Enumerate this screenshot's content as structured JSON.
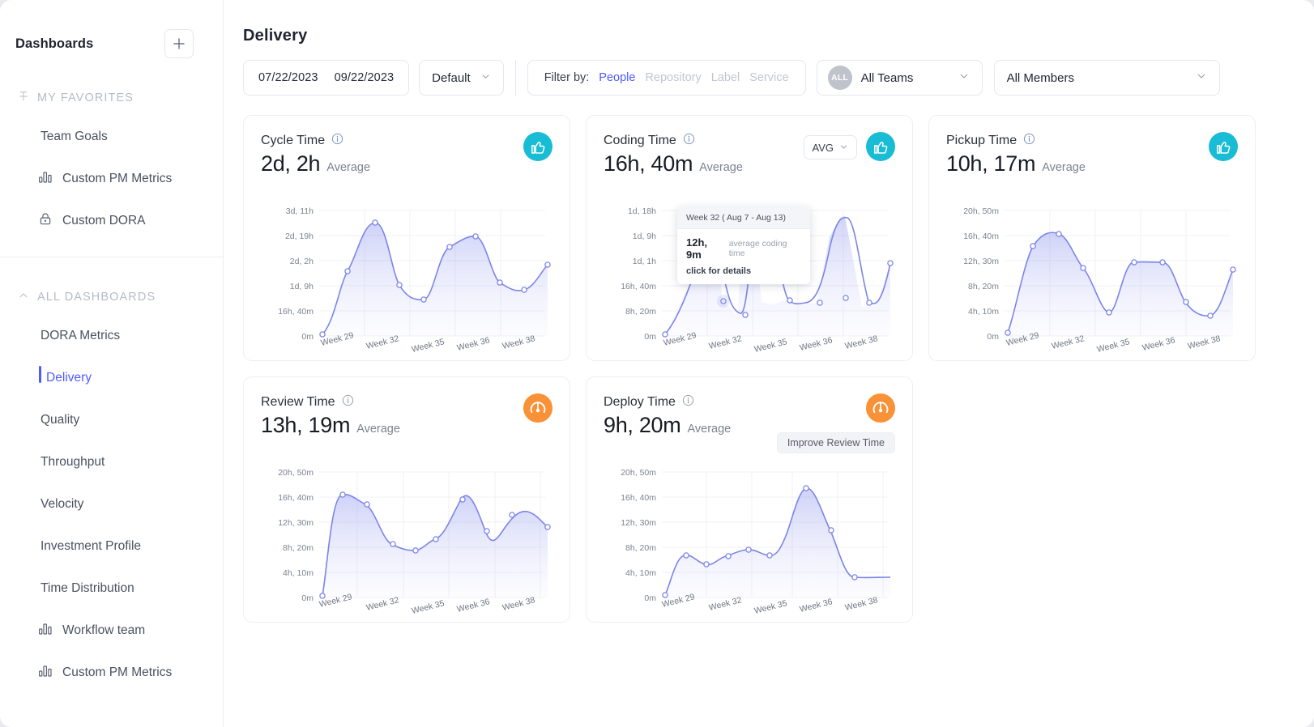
{
  "sidebar": {
    "title": "Dashboards",
    "add_button": "+",
    "sections": [
      {
        "label": "MY  FAVORITES",
        "icon": "pin-icon"
      },
      {
        "label": "ALL DASHBOARDS",
        "icon": "chevron-up-icon"
      }
    ],
    "favorites": [
      {
        "label": "Team Goals",
        "icon": null
      },
      {
        "label": "Custom PM Metrics",
        "icon": "bar-chart-icon"
      },
      {
        "label": "Custom DORA",
        "icon": "lock-icon"
      }
    ],
    "all_dashboards": [
      {
        "label": "DORA Metrics",
        "icon": null,
        "active": false
      },
      {
        "label": "Delivery",
        "icon": null,
        "active": true
      },
      {
        "label": "Quality",
        "icon": null,
        "active": false
      },
      {
        "label": "Throughput",
        "icon": null,
        "active": false
      },
      {
        "label": "Velocity",
        "icon": null,
        "active": false
      },
      {
        "label": "Investment Profile",
        "icon": null,
        "active": false
      },
      {
        "label": "Time Distribution",
        "icon": null,
        "active": false
      },
      {
        "label": "Workflow team",
        "icon": "bar-chart-icon",
        "active": false
      },
      {
        "label": "Custom PM Metrics",
        "icon": "bar-chart-icon",
        "active": false
      }
    ]
  },
  "header": {
    "title": "Delivery"
  },
  "toolbar": {
    "date_from": "07/22/2023",
    "date_to": "09/22/2023",
    "preset": "Default",
    "filter_label": "Filter by:",
    "filter_options": [
      {
        "label": "People",
        "selected": true
      },
      {
        "label": "Repository",
        "selected": false
      },
      {
        "label": "Label",
        "selected": false
      },
      {
        "label": "Service",
        "selected": false
      }
    ],
    "team_avatar": "ALL",
    "team": "All Teams",
    "members": "All Members"
  },
  "accent_colors": {
    "brand_blue": "#4f5bff",
    "line": "#7b85e8",
    "good_badge": "#18bcd4",
    "warn_badge": "#f99136"
  },
  "cards": [
    {
      "title": "Cycle Time",
      "value": "2d, 2h",
      "unit": "Average",
      "badge": "thumbs-up-icon",
      "badge_kind": "good",
      "selector": null,
      "pill": null
    },
    {
      "title": "Coding Time",
      "value": "16h, 40m",
      "unit": "Average",
      "badge": "thumbs-up-icon",
      "badge_kind": "good",
      "selector": "AVG",
      "pill": null,
      "tooltip": {
        "header": "Week 32 ( Aug 7 - Aug 13)",
        "value": "12h, 9m",
        "label": "average coding time",
        "hint": "click for details"
      }
    },
    {
      "title": "Pickup Time",
      "value": "10h, 17m",
      "unit": "Average",
      "badge": "thumbs-up-icon",
      "badge_kind": "good",
      "selector": null,
      "pill": null
    },
    {
      "title": "Review Time",
      "value": "13h, 19m",
      "unit": "Average",
      "badge": "gauge-icon",
      "badge_kind": "warn",
      "selector": null,
      "pill": null
    },
    {
      "title": "Deploy Time",
      "value": "9h, 20m",
      "unit": "Average",
      "badge": "gauge-icon",
      "badge_kind": "warn",
      "selector": null,
      "pill": "Improve Review Time"
    }
  ],
  "chart_data": [
    {
      "type": "area",
      "title": "Cycle Time",
      "xlabel": "",
      "ylabel": "",
      "grid": true,
      "legend": "none",
      "x": [
        "Week 29",
        "",
        "",
        "Week 32",
        "",
        "",
        "Week 35",
        "",
        "Week 36",
        "",
        "",
        "Week 38",
        ""
      ],
      "tick_labels": [
        "Week 29",
        "Week 32",
        "Week 35",
        "Week 36",
        "Week 38"
      ],
      "ytick_labels": [
        "0m",
        "16h, 40m",
        "1d, 9h",
        "2d, 2h",
        "2d, 19h",
        "3d, 11h"
      ],
      "yticks": [
        0,
        1,
        2,
        3,
        4,
        5
      ],
      "ylim": [
        0,
        5.4
      ],
      "values": [
        0.08,
        3.35,
        4.1,
        2.42,
        1.55,
        3.15,
        3.65,
        2.6,
        1.78,
        2.9
      ]
    },
    {
      "type": "area",
      "title": "Coding Time",
      "xlabel": "",
      "ylabel": "",
      "grid": true,
      "legend": "none",
      "tick_labels": [
        "Week 29",
        "Week 32",
        "Week 35",
        "Week 36",
        "Week 38"
      ],
      "ytick_labels": [
        "0m",
        "8h, 20m",
        "16h, 40m",
        "1d, 1h",
        "1d, 9h",
        "1d, 18h"
      ],
      "ylim": [
        0,
        5.4
      ],
      "values": [
        0.08,
        3.1,
        4.9,
        1.45,
        0.85,
        4.6,
        3.6,
        1.15,
        1.45,
        1.15,
        3.5
      ]
    },
    {
      "type": "area",
      "title": "Pickup Time",
      "xlabel": "",
      "ylabel": "",
      "grid": true,
      "legend": "none",
      "tick_labels": [
        "Week 29",
        "Week 32",
        "Week 35",
        "Week 36",
        "Week 38"
      ],
      "ytick_labels": [
        "0m",
        "4h, 10m",
        "8h, 20m",
        "12h, 30m",
        "16h, 40m",
        "20h, 50m"
      ],
      "ylim": [
        0,
        5.4
      ],
      "values": [
        0.15,
        3.65,
        4.1,
        2.75,
        1.25,
        2.98,
        2.98,
        1.65,
        1.1,
        2.5,
        3.55
      ]
    },
    {
      "type": "area",
      "title": "Review Time",
      "xlabel": "",
      "ylabel": "",
      "grid": true,
      "legend": "none",
      "tick_labels": [
        "Week 29",
        "Week 32",
        "Week 35",
        "Week 36",
        "Week 38"
      ],
      "ytick_labels": [
        "0m",
        "4h, 10m",
        "8h, 20m",
        "12h, 30m",
        "16h, 40m",
        "20h, 50m"
      ],
      "ylim": [
        0,
        5.4
      ],
      "values": [
        0.1,
        4.25,
        3.9,
        2.55,
        2.18,
        2.55,
        3.95,
        2.9,
        3.5,
        2.95
      ]
    },
    {
      "type": "area",
      "title": "Deploy Time",
      "xlabel": "",
      "ylabel": "",
      "grid": true,
      "legend": "none",
      "tick_labels": [
        "Week 29",
        "Week 32",
        "Week 35",
        "Week 36",
        "Week 38"
      ],
      "ytick_labels": [
        "0m",
        "4h, 10m",
        "8h, 20m",
        "12h, 30m",
        "16h, 40m",
        "20h, 50m"
      ],
      "ylim": [
        0,
        5.4
      ],
      "values": [
        0.15,
        1.72,
        1.28,
        1.68,
        1.95,
        1.58,
        4.4,
        2.85,
        0.95,
        0.85
      ]
    }
  ]
}
